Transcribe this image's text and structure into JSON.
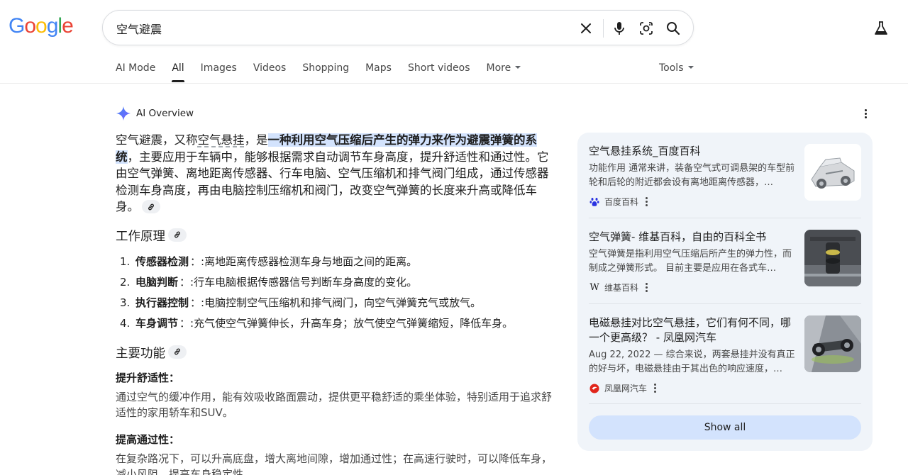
{
  "logo": {
    "letters": [
      "G",
      "o",
      "o",
      "g",
      "l",
      "e"
    ],
    "colors": [
      "#4285f4",
      "#ea4335",
      "#fbbc05",
      "#4285f4",
      "#34a853",
      "#ea4335"
    ]
  },
  "search": {
    "query": "空气避震"
  },
  "tabs": [
    {
      "label": "AI Mode"
    },
    {
      "label": "All",
      "active": true
    },
    {
      "label": "Images"
    },
    {
      "label": "Videos"
    },
    {
      "label": "Shopping"
    },
    {
      "label": "Maps"
    },
    {
      "label": "Short videos"
    },
    {
      "label": "More"
    }
  ],
  "tools_label": "Tools",
  "ai_overview": {
    "title": "AI Overview",
    "intro": {
      "p1": "空气避震，又称",
      "p2": "空气悬挂",
      "p3": "，是",
      "highlight": "一种利用空气压缩后产生的弹力来作为避震弹簧的系统",
      "p4": "，主要应用于车辆中，能够根据需求自动调节车身高度，提升舒适性和通过性。它由空气弹簧、离地距离传感器、行车电脑、空气压缩机和排气阀门组成，通过传感器检测车身高度，再由电脑控制压缩机和阀门，改变空气弹簧的长度来升高或降低车身。"
    },
    "section1": {
      "title": "工作原理",
      "steps": [
        {
          "num": "1.",
          "bold": "传感器检测",
          "text": "：:离地距离传感器检测车身与地面之间的距离。"
        },
        {
          "num": "2.",
          "bold": "电脑判断",
          "text": "：:行车电脑根据传感器信号判断车身高度的变化。"
        },
        {
          "num": "3.",
          "bold": "执行器控制",
          "text": "：:电脑控制空气压缩机和排气阀门，向空气弹簧充气或放气。"
        },
        {
          "num": "4.",
          "bold": "车身调节",
          "text": "：:充气使空气弹簧伸长，升高车身；放气使空气弹簧缩短，降低车身。"
        }
      ]
    },
    "section2": {
      "title": "主要功能",
      "f1_title": "提升舒适性：",
      "f1_desc": "通过空气的缓冲作用，能有效吸收路面震动，提供更平稳舒适的乘坐体验，特别适用于追求舒适性的家用轿车和SUV。",
      "f2_title": "提高通过性：",
      "f2_desc": "在复杂路况下，可以升高底盘，增大离地间隙，增加通过性；在高速行驶时，可以降低车身，减小风阻，提高车身稳定性。"
    }
  },
  "sources": [
    {
      "title": "空气悬挂系统_百度百科",
      "snippet": "功能作用 通常来讲，装备空气式可调悬架的车型前轮和后轮的附近都会设有离地距离传感器，…",
      "source": "百度百科",
      "icon": "baidu-icon"
    },
    {
      "title": "空气弹簧- 维基百科，自由的百科全书",
      "snippet": "空气弹簧是指利用空气压缩后所产生的弹力性，而制成之弹簧形式。 目前主要是应用在各式车…",
      "source": "维基百科",
      "icon": "wikipedia-icon"
    },
    {
      "title": "电磁悬挂对比空气悬挂，它们有何不同，哪一个更高级？ - 凤凰网汽车",
      "snippet": "Aug 22, 2022 — 综合来说，两套悬挂并没有真正的好与坏，电磁悬挂由于其出色的响应速度，…",
      "source": "凤凰网汽车",
      "icon": "ifeng-icon"
    }
  ],
  "show_all_label": "Show all"
}
